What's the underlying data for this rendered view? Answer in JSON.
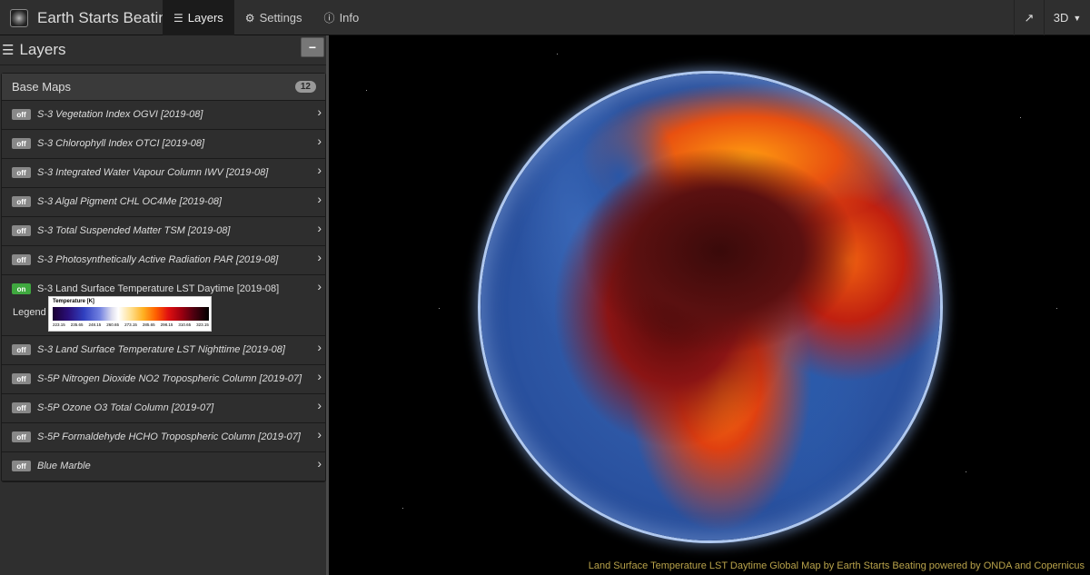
{
  "app": {
    "title": "Earth Starts Beating"
  },
  "nav": {
    "tabs": [
      {
        "label": "Layers",
        "icon": "list-icon"
      },
      {
        "label": "Settings",
        "icon": "gear-icon"
      },
      {
        "label": "Info",
        "icon": "info-icon"
      }
    ],
    "share_icon": "share-icon",
    "mode": {
      "label": "3D",
      "icon": "caret-down-icon"
    }
  },
  "sidebar": {
    "title": "Layers",
    "collapse_label": "−",
    "group": {
      "title": "Base Maps",
      "count": "12",
      "layers": [
        {
          "label": "S-3 Vegetation Index OGVI [2019-08]",
          "state": "off"
        },
        {
          "label": "S-3 Chlorophyll Index OTCI [2019-08]",
          "state": "off"
        },
        {
          "label": "S-3 Integrated Water Vapour Column IWV [2019-08]",
          "state": "off"
        },
        {
          "label": "S-3 Algal Pigment CHL OC4Me [2019-08]",
          "state": "off"
        },
        {
          "label": "S-3 Total Suspended Matter TSM [2019-08]",
          "state": "off"
        },
        {
          "label": "S-3 Photosynthetically Active Radiation PAR [2019-08]",
          "state": "off"
        },
        {
          "label": "S-3 Land Surface Temperature LST Daytime [2019-08]",
          "state": "on"
        },
        {
          "label": "S-3 Land Surface Temperature LST Nighttime [2019-08]",
          "state": "off"
        },
        {
          "label": "S-5P Nitrogen Dioxide NO2 Tropospheric Column [2019-07]",
          "state": "off"
        },
        {
          "label": "S-5P Ozone O3 Total Column [2019-07]",
          "state": "off"
        },
        {
          "label": "S-5P Formaldehyde HCHO Tropospheric Column [2019-07]",
          "state": "off"
        },
        {
          "label": "Blue Marble",
          "state": "off"
        }
      ],
      "legend": {
        "label": "Legend",
        "title": "Temperature [K]",
        "ticks": [
          "223.15",
          "235.65",
          "248.15",
          "260.65",
          "273.15",
          "285.65",
          "298.15",
          "310.65",
          "323.15"
        ]
      }
    }
  },
  "map": {
    "credit": "Land Surface Temperature LST Daytime Global Map by Earth Starts Beating powered by ONDA and Copernicus"
  },
  "colors": {
    "navbar": "#2f2f2f",
    "toggle_on": "#3fa83f",
    "toggle_off": "#888888",
    "credit_text": "#b8a24a"
  }
}
